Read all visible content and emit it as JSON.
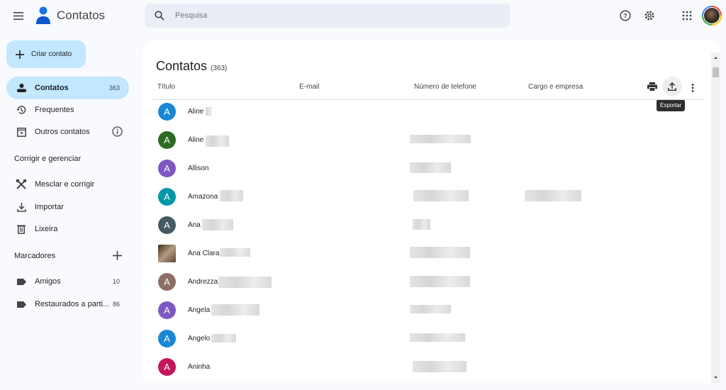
{
  "app": {
    "title": "Contatos"
  },
  "search": {
    "placeholder": "Pesquisa"
  },
  "sidebar": {
    "create_label": "Criar contato",
    "items": [
      {
        "label": "Contatos",
        "count": "363",
        "icon": "person-icon",
        "active": true
      },
      {
        "label": "Frequentes",
        "icon": "history-icon"
      },
      {
        "label": "Outros contatos",
        "icon": "archive-download-icon"
      }
    ],
    "manage_title": "Corrigir e gerenciar",
    "manage_items": [
      {
        "label": "Mesclar e corrigir",
        "icon": "tools-icon"
      },
      {
        "label": "Importar",
        "icon": "download-icon"
      },
      {
        "label": "Lixeira",
        "icon": "trash-icon"
      }
    ],
    "labels_title": "Marcadores",
    "labels": [
      {
        "label": "Amigos",
        "count": "10"
      },
      {
        "label": "Restaurados a parti...",
        "count": "86"
      }
    ]
  },
  "main": {
    "title": "Contatos",
    "count": "(363)",
    "columns": [
      "Título",
      "E-mail",
      "Número de telefone",
      "Cargo e empresa"
    ],
    "tooltip": "Exportar",
    "accent": "#c2e7ff",
    "rows": [
      {
        "name": "Aline",
        "initial": "A",
        "color": "#1a87d4"
      },
      {
        "name": "Aline",
        "initial": "A",
        "color": "#2e6b22"
      },
      {
        "name": "Allison",
        "initial": "A",
        "color": "#7e57c2"
      },
      {
        "name": "Amazona",
        "initial": "A",
        "color": "#0097a7"
      },
      {
        "name": "Ana",
        "initial": "A",
        "color": "#455a64"
      },
      {
        "name": "Ana Clara",
        "initial": "",
        "color": "#8a7060"
      },
      {
        "name": "Andrezza",
        "initial": "A",
        "color": "#8d6e63"
      },
      {
        "name": "Angela",
        "initial": "A",
        "color": "#7e57c2"
      },
      {
        "name": "Angelo",
        "initial": "A",
        "color": "#1a87d4"
      },
      {
        "name": "Aninha",
        "initial": "A",
        "color": "#c2185b"
      }
    ]
  }
}
